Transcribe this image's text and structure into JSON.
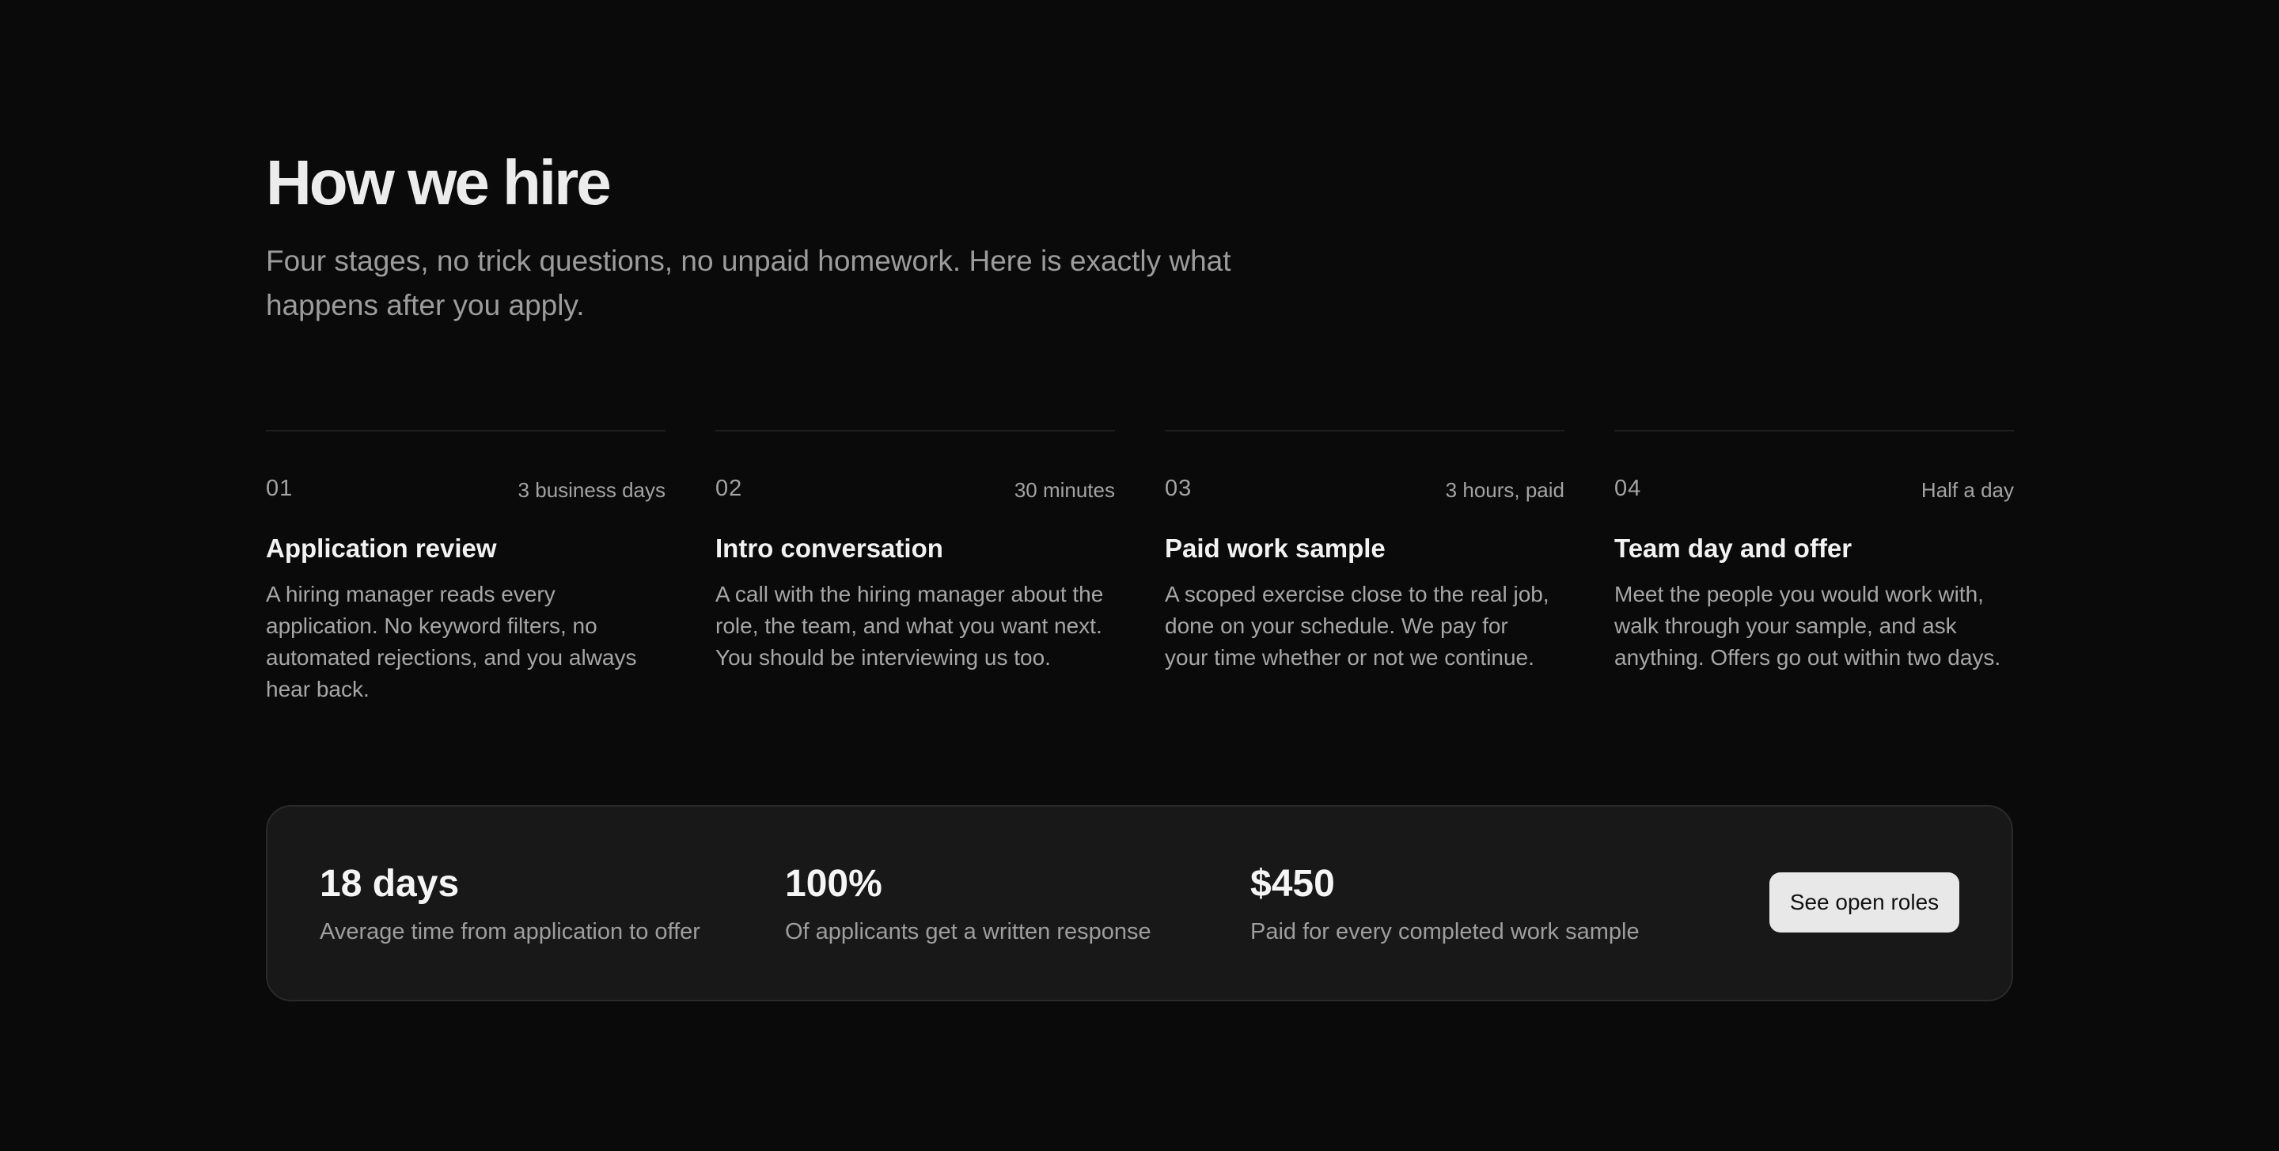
{
  "header": {
    "title": "How we hire",
    "subtitle": "Four stages, no trick questions, no unpaid homework. Here is exactly what happens after you apply."
  },
  "steps": [
    {
      "number": "01",
      "duration": "3 business days",
      "title": "Application review",
      "description": "A hiring manager reads every application. No keyword filters, no automated rejections, and you always hear back."
    },
    {
      "number": "02",
      "duration": "30 minutes",
      "title": "Intro conversation",
      "description": "A call with the hiring manager about the role, the team, and what you want next. You should be interviewing us too."
    },
    {
      "number": "03",
      "duration": "3 hours, paid",
      "title": "Paid work sample",
      "description": "A scoped exercise close to the real job, done on your schedule. We pay for your time whether or not we continue."
    },
    {
      "number": "04",
      "duration": "Half a day",
      "title": "Team day and offer",
      "description": "Meet the people you would work with, walk through your sample, and ask anything. Offers go out within two days."
    }
  ],
  "stats": [
    {
      "value": "18 days",
      "label": "Average time from application to offer"
    },
    {
      "value": "100%",
      "label": "Of applicants get a written response"
    },
    {
      "value": "$450",
      "label": "Paid for every completed work sample"
    }
  ],
  "cta": {
    "label": "See open roles"
  },
  "colors": {
    "background": "#0a0a0a",
    "card": "#181818",
    "button": "#e8e8e8"
  }
}
